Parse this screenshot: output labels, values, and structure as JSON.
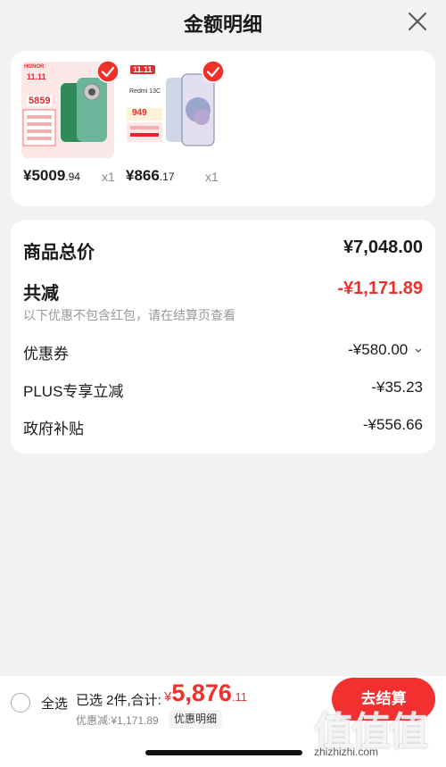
{
  "header": {
    "title": "金额明细",
    "close_icon": "close-icon"
  },
  "products": [
    {
      "brand": "HONOR",
      "tag": "11.11",
      "promo_price": "5859",
      "price_symbol": "¥",
      "price_int": "5009",
      "price_dec": ".94",
      "qty": "x1",
      "accent": "#e8262f"
    },
    {
      "brand": "Redmi 13C",
      "tag": "11.11",
      "promo_price": "949",
      "price_symbol": "¥",
      "price_int": "866",
      "price_dec": ".17",
      "qty": "x1",
      "accent": "#e8262f"
    }
  ],
  "summary": {
    "total_label": "商品总价",
    "total_value": "¥7,048.00",
    "reduce_label": "共减",
    "reduce_value": "-¥1,171.89",
    "reduce_hint": "以下优惠不包含红包，请在结算页查看",
    "items": [
      {
        "label": "优惠券",
        "value": "-¥580.00"
      },
      {
        "label": "PLUS专享立减",
        "value": "-¥35.23"
      },
      {
        "label": "政府补贴",
        "value": "-¥556.66"
      }
    ]
  },
  "bottom": {
    "select_all": "全选",
    "selected_info": "已选 2件,合计:",
    "total_symbol": "¥",
    "total_int": "5,876",
    "total_dec": ".11",
    "discount": "优惠减:¥1,171.89",
    "detail_button": "优惠明细",
    "pay_button": "去结算"
  },
  "watermark": {
    "text": "值值值",
    "url": "zhizhizhi.com"
  },
  "colors": {
    "accent": "#f0302a",
    "background": "#f2f2f2"
  }
}
